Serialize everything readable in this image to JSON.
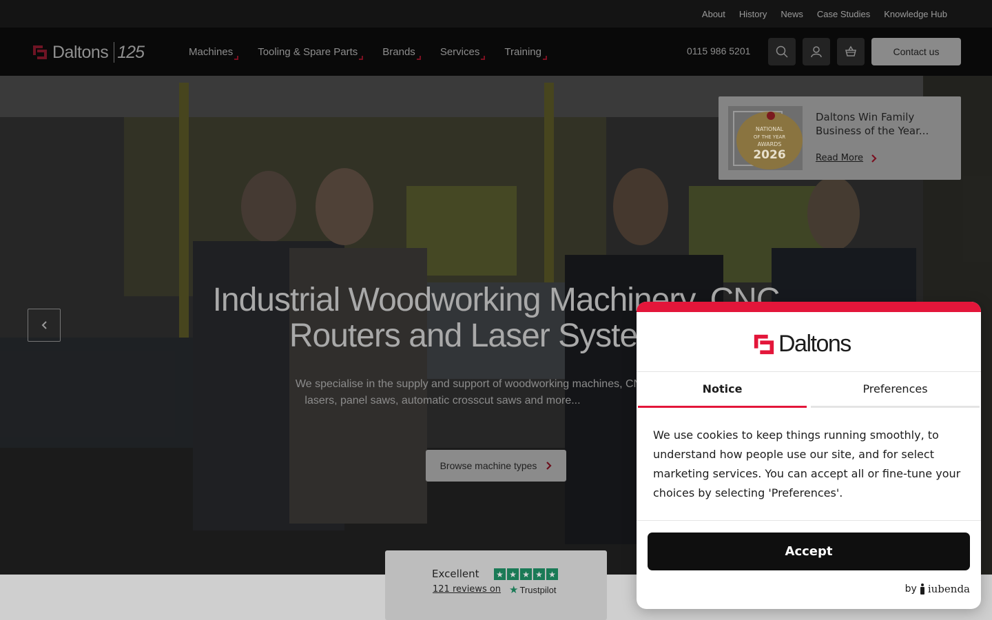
{
  "topbar": {
    "links": [
      "About",
      "History",
      "News",
      "Case Studies",
      "Knowledge Hub"
    ]
  },
  "header": {
    "logo_word": "Daltons",
    "logo_anniversary": "125",
    "nav": [
      "Machines",
      "Tooling & Spare Parts",
      "Brands",
      "Services",
      "Training"
    ],
    "phone": "0115 986 5201",
    "contact_label": "Contact us",
    "icons": [
      "search-icon",
      "account-icon",
      "basket-icon"
    ]
  },
  "hero": {
    "title_line1": "Industrial Woodworking Machinery, CNC",
    "title_line2": "Routers and Laser Syste",
    "subtitle_line1": "We specialise in the supply and support of woodworking machines, CN",
    "subtitle_line2": "lasers, panel saws, automatic crosscut saws and more...",
    "cta_label": "Browse machine types"
  },
  "news_card": {
    "title": "Daltons Win Family Business of the Year...",
    "link_label": "Read More",
    "award_text": "NATIONAL FAMILY BUSINESS OF THE YEAR AWARDS 2026"
  },
  "trustpilot": {
    "rating_word": "Excellent",
    "reviews": "121 reviews on",
    "brand": "Trustpilot",
    "stars": 5
  },
  "cookie": {
    "logo_word": "Daltons",
    "tabs": [
      "Notice",
      "Preferences"
    ],
    "active_tab": "Notice",
    "text": "We use cookies to keep things running smoothly, to understand how people use our site, and for select marketing services. You can accept all or fine-tune your choices by selecting 'Preferences'.",
    "accept_label": "Accept",
    "powered_by": "by",
    "powered_brand": "iubenda"
  },
  "colors": {
    "brand_red": "#e3163a",
    "trust_green": "#1a7a56",
    "dark_bg": "#090909"
  }
}
